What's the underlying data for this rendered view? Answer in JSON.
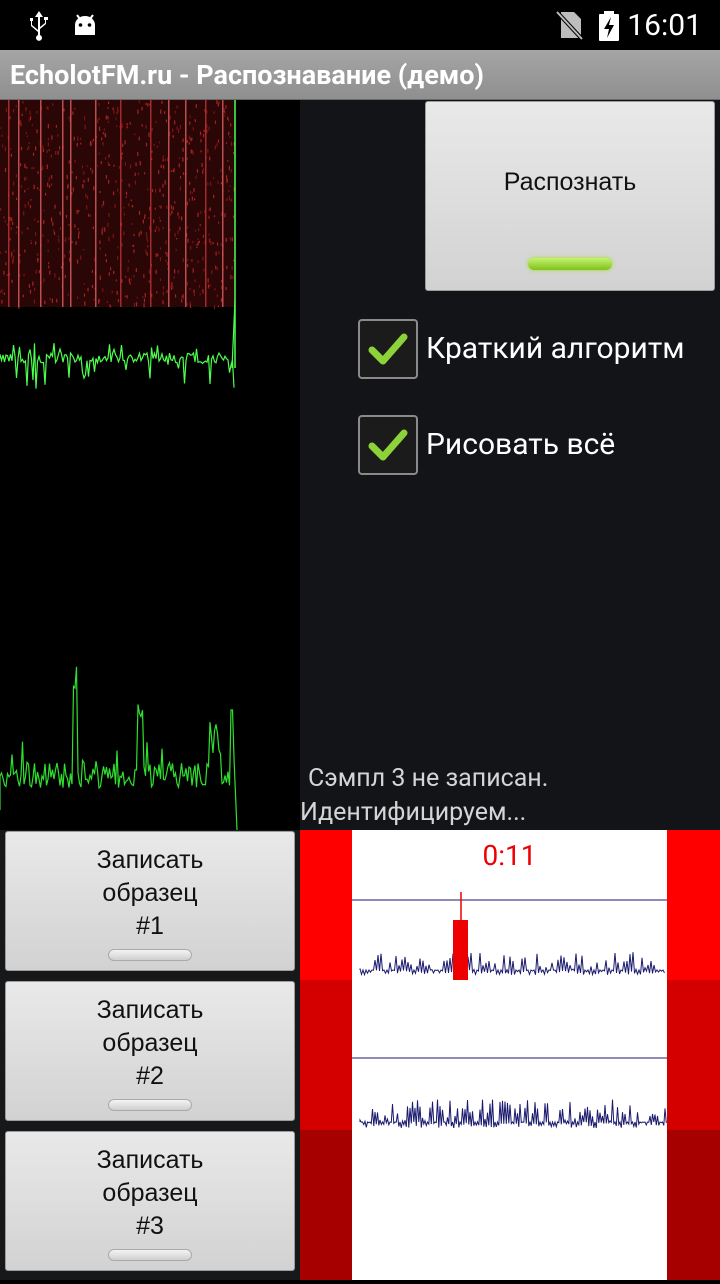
{
  "status_bar": {
    "time": "16:01",
    "left_icons": [
      "usb-icon",
      "android-icon"
    ],
    "right_icons": [
      "no-sim-icon",
      "battery-charging-icon"
    ]
  },
  "app": {
    "title": "EcholotFM.ru - Распознавание (демо)"
  },
  "recognize_button": {
    "label": "Распознать",
    "indicator": "on"
  },
  "options": {
    "short_algorithm": {
      "label": "Краткий алгоритм",
      "checked": true
    },
    "draw_all": {
      "label": "Рисовать всё",
      "checked": true
    }
  },
  "status": {
    "line1": "Сэмпл 3 не записан.",
    "line2": "Идентифицируем..."
  },
  "record_buttons": [
    {
      "line1": "Записать",
      "line2": "образец",
      "line3": "#1",
      "indicator": "off"
    },
    {
      "line1": "Записать",
      "line2": "образец",
      "line3": "#2",
      "indicator": "off"
    },
    {
      "line1": "Записать",
      "line2": "образец",
      "line3": "#3",
      "indicator": "off"
    }
  ],
  "timer": "0:11",
  "colors": {
    "accent_green": "#7ec21e",
    "check_green": "#8ed23a",
    "waveform_navy": "#1a1a6e",
    "timer_red": "#ee0000",
    "spectrum_green": "#4dff4d"
  }
}
